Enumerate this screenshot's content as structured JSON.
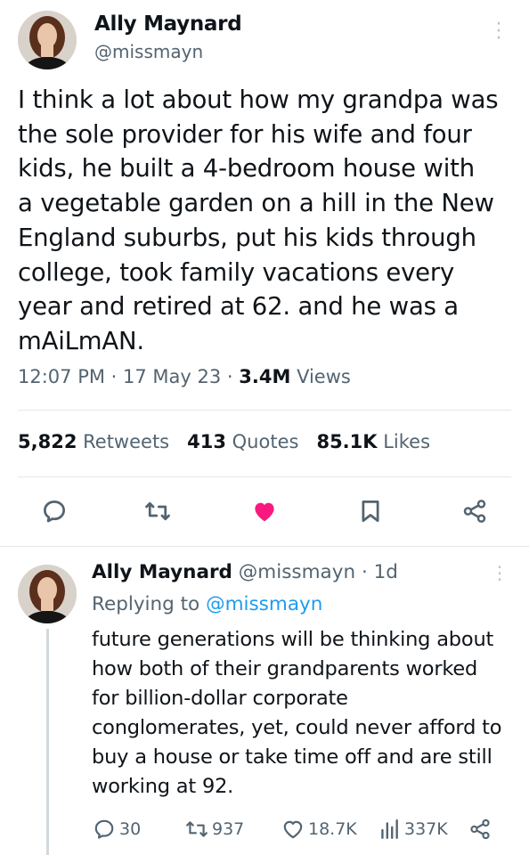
{
  "tweet": {
    "author_name": "Ally Maynard",
    "author_handle": "@missmayn",
    "text": "I think a lot about how my grandpa was\nthe sole provider for his wife and four\nkids, he built a 4-bedroom house with\na vegetable garden on a hill in the New\nEngland suburbs, put his kids through\ncollege, took family vacations every\nyear and retired at 62. and he was a\nmAiLmAN.",
    "time": "12:07 PM",
    "date": "17 May 23",
    "views_count": "3.4M",
    "views_label": "Views",
    "retweets_count": "5,822",
    "retweets_label": "Retweets",
    "quotes_count": "413",
    "quotes_label": "Quotes",
    "likes_count": "85.1K",
    "likes_label": "Likes",
    "liked": true,
    "icons": [
      "reply-icon",
      "retweet-icon",
      "heart-icon",
      "bookmark-icon",
      "share-icon",
      "more-icon"
    ],
    "accent_color": "#1d9bf0",
    "like_color": "#f91880"
  },
  "reply": {
    "author_name": "Ally Maynard",
    "author_handle": "@missmayn",
    "age": "1d",
    "replying_label": "Replying to",
    "replying_handle": "@missmayn",
    "text": "future generations will be thinking about\nhow both of their grandparents worked\nfor billion-dollar corporate\nconglomerates, yet, could never afford to\nbuy a house or take time off and are still\nworking at 92.",
    "reply_count": "30",
    "retweet_count": "937",
    "like_count": "18.7K",
    "view_count": "337K"
  }
}
